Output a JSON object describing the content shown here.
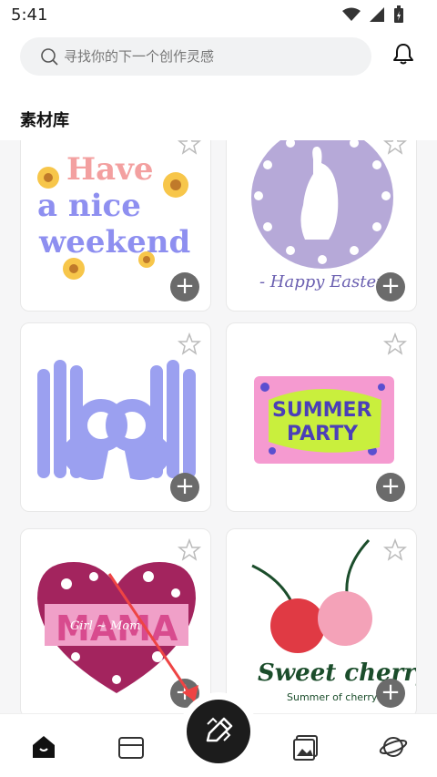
{
  "status": {
    "time": "5:41"
  },
  "header": {
    "search_placeholder": "寻找你的下一个创作灵感",
    "section_title": "素材库"
  },
  "cards": [
    {
      "name": "have-a-nice-weekend",
      "text_lines": [
        "Have",
        "a nice",
        "weekend"
      ]
    },
    {
      "name": "happy-easter",
      "caption": "- Happy Easter -"
    },
    {
      "name": "ok-hands"
    },
    {
      "name": "summer-party",
      "text_lines": [
        "SUMMER",
        "PARTY"
      ]
    },
    {
      "name": "mama-heart",
      "title": "MAMA",
      "subtitle": "Girl ~ Mom"
    },
    {
      "name": "sweet-cherry",
      "title": "Sweet cherry",
      "subtitle": "Summer of cherry"
    }
  ],
  "icons": {
    "search": "search-icon",
    "bell": "bell-icon",
    "star": "star-icon",
    "add": "plus-icon"
  },
  "colors": {
    "accent": "#1c1c1c",
    "card_bg": "#ffffff",
    "grid_bg": "#f6f6f7"
  },
  "bottom_nav": {
    "items": [
      "home-icon",
      "folder-icon",
      "edit-icon",
      "gallery-icon",
      "planet-icon"
    ]
  }
}
